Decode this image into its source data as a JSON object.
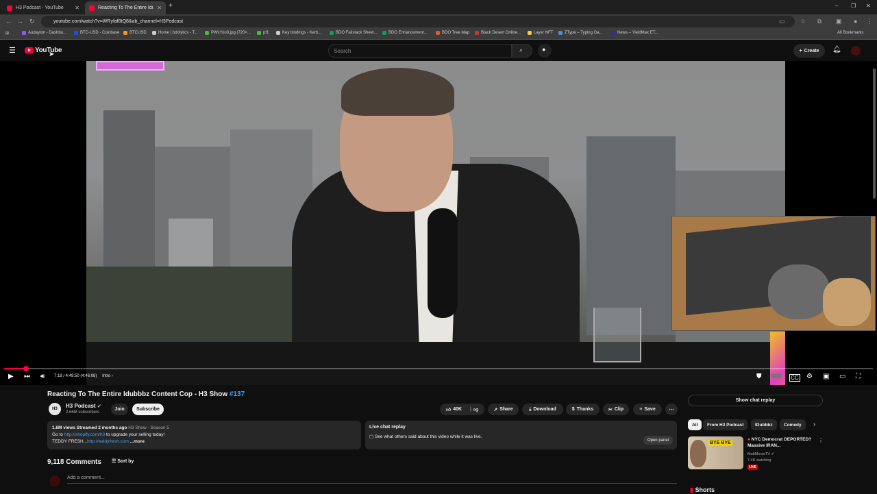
{
  "tabs": [
    {
      "label": "H3 Podcast - YouTube",
      "active": false
    },
    {
      "label": "Reacting To The Entire Idubbbz",
      "active": true
    }
  ],
  "new_tab_glyph": "+",
  "url": "youtube.com/watch?v=WRyfaf8tQ8&ab_channel=H3Podcast",
  "bookmarks": [
    {
      "label": "Audaylon - Dashbo...",
      "color": "#8c59ff"
    },
    {
      "label": "BTC-USD - Coinbase",
      "color": "#1652f0"
    },
    {
      "label": "BTCUSD",
      "color": "#f7931a"
    },
    {
      "label": "Home | bdolytics - T...",
      "color": "#cccccc"
    },
    {
      "label": "PWxYoo3.jpg (720×...",
      "color": "#3fbf3f"
    },
    {
      "label": "pf1",
      "color": "#3fbf3f"
    },
    {
      "label": "Key bindings - Kerb...",
      "color": "#cccccc"
    },
    {
      "label": "BDO Failstack Sheet...",
      "color": "#0f9d58"
    },
    {
      "label": "BDO Enhancement...",
      "color": "#0f9d58"
    },
    {
      "label": "BDO Tree Map",
      "color": "#e05a2b"
    },
    {
      "label": "Black Desert Online...",
      "color": "#d0312d"
    },
    {
      "label": "Layer NFT",
      "color": "#f2c94c"
    },
    {
      "label": "ZType – Typing Ga...",
      "color": "#4a90d9"
    },
    {
      "label": "News – YieldMax ET...",
      "color": "#2f2f8f"
    }
  ],
  "all_bookmarks": "All Bookmarks",
  "youtube": {
    "logo_text": "YouTube",
    "search_placeholder": "Search",
    "create_label": "Create"
  },
  "player": {
    "time_text": "7:18 / 4:49:50 (4:46:08)",
    "chapter": "Intro",
    "progress_fraction": 0.025
  },
  "video": {
    "title": "Reacting To The Entire Idubbbz Content Cop - H3 Show ",
    "title_tag": "#137",
    "channel_avatar_text": "H3",
    "channel": "H3 Podcast",
    "subscribers": "2.66M subscribers",
    "join_label": "Join",
    "subscribe_label": "Subscribe",
    "likes": "40K",
    "share_label": "Share",
    "download_label": "Download",
    "thanks_label": "Thanks",
    "clip_label": "Clip",
    "save_label": "Save"
  },
  "description": {
    "meta": "1.6M views  Streamed 2 months ago",
    "series": "H3 Show - Season 5",
    "line2_prefix": "Go to ",
    "line2_link": "http://shopify.com/h3",
    "line2_suffix": " to upgrade your selling today!",
    "line3_prefix": "TEDDY FRESH...",
    "line3_link": "http://teddyfresh.com",
    "more": "...more"
  },
  "chat_replay": {
    "title": "Live chat replay",
    "text": "See what others said about this video while it was live.",
    "open_panel": "Open panel"
  },
  "comments": {
    "count": "9,118 Comments",
    "sort_by": "Sort by",
    "add_placeholder": "Add a comment..."
  },
  "sidebar": {
    "show_chat_replay": "Show chat replay",
    "chips": [
      "All",
      "From H3 Podcast",
      "IDubbbz",
      "Comedy"
    ],
    "rec": {
      "thumb_text": "BYE BYE",
      "title": "NYC Democrat DEPORTED? Massive IRAN...",
      "channel": "MattMorseTV",
      "watching": "7.4K watching",
      "live_badge": "LIVE"
    },
    "shorts": "Shorts"
  }
}
